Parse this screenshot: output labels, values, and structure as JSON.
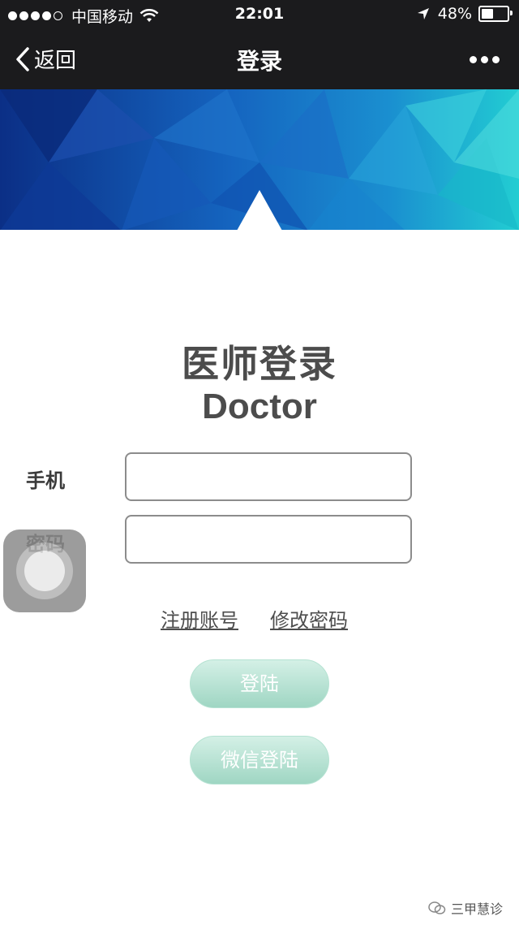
{
  "status_bar": {
    "carrier": "中国移动",
    "time": "22:01",
    "battery": "48%",
    "battery_level": 0.48,
    "icons": [
      "signal-dots",
      "wifi-icon",
      "location-arrow-icon",
      "battery-icon"
    ]
  },
  "nav": {
    "back_label": "返回",
    "title": "登录",
    "icons": [
      "chevron-left-icon",
      "more-icon"
    ]
  },
  "banner": {
    "colors": [
      "#0d3f9e",
      "#1677c9",
      "#1fc5cf"
    ]
  },
  "login": {
    "title_cn": "医师登录",
    "title_en": "Doctor",
    "phone_label": "手机",
    "phone_value": "",
    "password_label": "密码",
    "password_value": "",
    "register_link": "注册账号",
    "change_password_link": "修改密码",
    "login_button": "登陆",
    "wechat_login_button": "微信登陆"
  },
  "watermark": {
    "text": "三甲慧诊"
  },
  "colors": {
    "bar_bg": "#1b1b1d",
    "button_green": "#9fd6c3",
    "label_text": "#3a3a3a"
  }
}
